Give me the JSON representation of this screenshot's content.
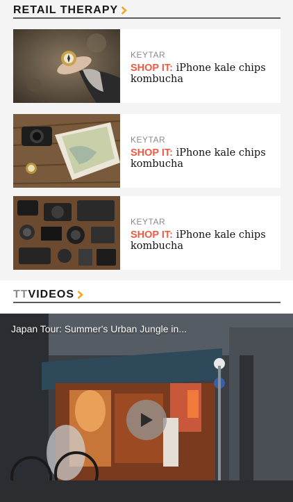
{
  "retail": {
    "heading": "RETAIL THERAPY",
    "items": [
      {
        "category": "KEYTAR",
        "shop_label": "SHOP IT:",
        "title": "iPhone kale chips kombucha",
        "image": "hand-holding-compass-photo"
      },
      {
        "category": "KEYTAR",
        "shop_label": "SHOP IT:",
        "title": "iPhone kale chips kombucha",
        "image": "camera-map-compass-photo"
      },
      {
        "category": "KEYTAR",
        "shop_label": "SHOP IT:",
        "title": "iPhone kale chips kombucha",
        "image": "camera-gear-flatlay-photo"
      }
    ]
  },
  "videos": {
    "heading_prefix": "TT",
    "heading_suffix": "VIDEOS",
    "featured_title": "Japan Tour: Summer's Urban Jungle in..."
  },
  "colors": {
    "accent_orange": "#f5a623",
    "shop_red": "#ef5a44"
  }
}
